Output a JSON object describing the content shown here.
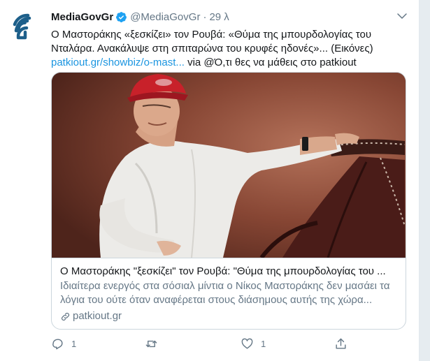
{
  "tweet": {
    "display_name": "MediaGovGr",
    "handle": "@MediaGovGr",
    "separator": "·",
    "time": "29 λ",
    "text_line1": "Ο Μαστοράκης «ξεσκίζει» τον Ρουβά: «Θύμα της μπουρδολογίας του Νταλάρα. Ανακάλυψε στη σπιταρώνα του κρυφές ηδονές»... (Εικόνες)",
    "link_text": "patkiout.gr/showbiz/o-mast...",
    "via_text": "via @Ό,τι θες να μάθεις στο patkiout"
  },
  "card": {
    "title": "Ο Μαστοράκης \"ξεσκίζει\" τον Ρουβά: \"Θύμα της μπουρδολογίας του ...",
    "description": "Ιδιαίτερα ενεργός στα σόσιαλ μίντια ο Νίκος Μαστοράκης δεν μασάει τα λόγια του ούτε όταν αναφέρεται στους διάσημους αυτής της χώρα...",
    "domain": "patkiout.gr"
  },
  "actions": {
    "reply_count": "1",
    "retweet_count": "",
    "like_count": "1"
  },
  "icons": {
    "avatar": "broadcast-logo-icon",
    "verified": "verified-badge-icon",
    "more": "chevron-down-icon",
    "link": "link-icon",
    "reply": "reply-icon",
    "retweet": "retweet-icon",
    "like": "heart-icon",
    "share": "share-icon"
  },
  "colors": {
    "brand_blue": "#1da1f2",
    "link": "#1b95e0",
    "secondary_text": "#657786",
    "avatar_logo": "#1d5f8a"
  }
}
